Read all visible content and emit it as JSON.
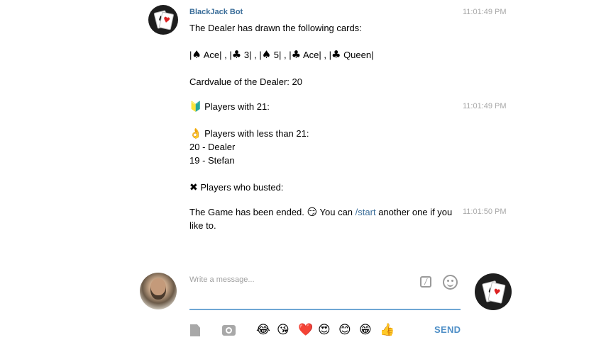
{
  "message": {
    "sender": "BlackJack Bot",
    "time1": "11:01:49 PM",
    "time2": "11:01:49 PM",
    "time3": "11:01:50 PM",
    "dealer_drawn": "The Dealer has drawn the following cards:",
    "cards": [
      {
        "suit": "♠",
        "label": "Ace|"
      },
      {
        "suit": "♣",
        "label": "3|"
      },
      {
        "suit": "♠",
        "label": "5|"
      },
      {
        "suit": "♣",
        "label": "Ace|"
      },
      {
        "suit": "♣",
        "label": "Queen|"
      }
    ],
    "cardvalue": "Cardvalue of the Dealer: 20",
    "players21": "Players with 21:",
    "players_less": "Players with less than 21:",
    "player_rows": [
      "20 - Dealer",
      "19 - Stefan"
    ],
    "players_busted": "Players who busted:",
    "ended_prefix": "The Game has been ended.",
    "ended_mid": "You can",
    "ended_link": "/start",
    "ended_suffix": "another one if you",
    "ended_line2": "like to."
  },
  "composer": {
    "placeholder": "Write a message...",
    "send_label": "SEND",
    "emojis": [
      "😂",
      "😘",
      "❤️",
      "😍",
      "😊",
      "😁",
      "👍"
    ]
  },
  "icons": {
    "bot_avatar": "playing-cards-icon",
    "beginner": "beginner-icon",
    "ok_hand": "ok-hand-icon",
    "cross": "cross-mark-icon",
    "smirk": "smirk-icon",
    "attach": "file-icon",
    "camera": "camera-icon",
    "command": "slash-command-icon",
    "smile": "smiley-icon"
  },
  "colors": {
    "link": "#3a6d99",
    "send": "#4f8fc7",
    "input_underline": "#6fa7d4",
    "timestamp": "#a8a8a8"
  }
}
